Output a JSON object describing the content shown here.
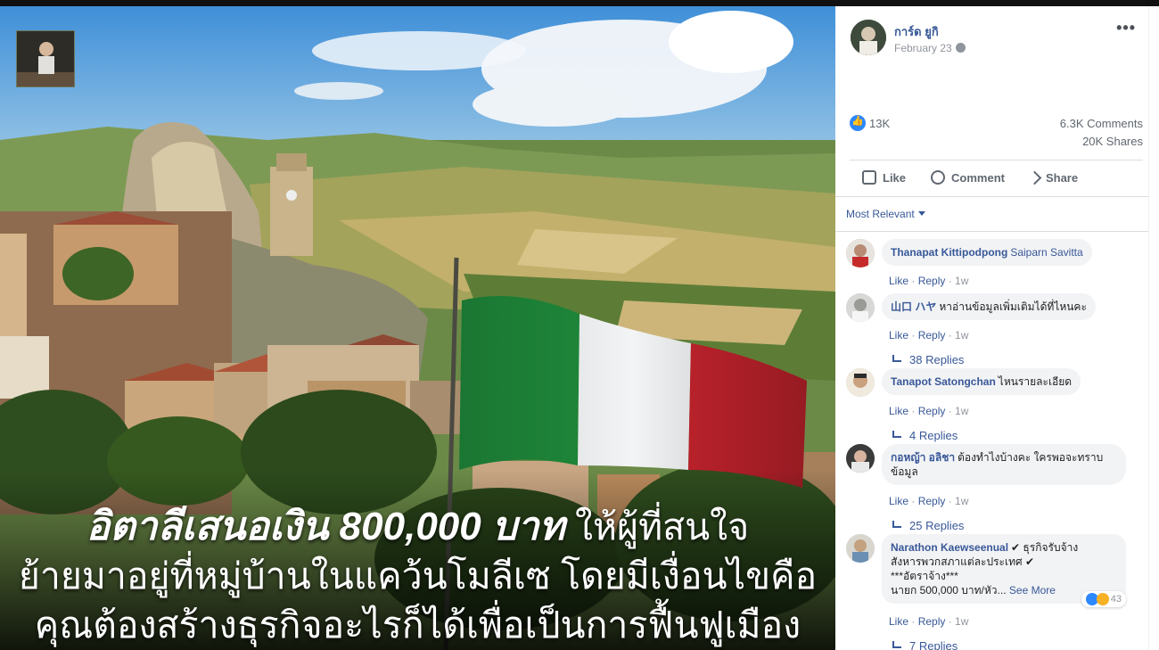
{
  "post": {
    "headline_bold": "อิตาลีเสนอเงิน 800,000 บาท",
    "headline_rest": "ให้ผู้ที่สนใจ",
    "headline_line2": "ย้ายมาอยู่ที่หมู่บ้านในแคว้นโมลีเซ โดยมีเงื่อนไขคือ",
    "headline_line3": "คุณต้องสร้างธุรกิจอะไรก็ได้เพื่อเป็นการฟื้นฟูเมือง"
  },
  "author": {
    "name": "การ์ด ยูกิ",
    "date": "February 23",
    "more": "•••"
  },
  "stats": {
    "likes": "13K",
    "comments": "6.3K Comments",
    "shares": "20K Shares"
  },
  "actions": {
    "like": "Like",
    "comment": "Comment",
    "share": "Share"
  },
  "sort": {
    "label": "Most Relevant"
  },
  "comments": [
    {
      "name": "Thanapat Kittipodpong",
      "text": "Saiparn Savitta",
      "like": "Like",
      "reply": "Reply",
      "time": "1w"
    },
    {
      "name": "山口 ハヤ",
      "text": "หาอ่านข้อมูลเพิ่มเติมได้ที่ไหนคะ",
      "like": "Like",
      "reply": "Reply",
      "time": "1w",
      "replies": "38 Replies"
    },
    {
      "name": "Tanapot Satongchan",
      "text": "ไหนรายละเอียด",
      "like": "Like",
      "reply": "Reply",
      "time": "1w",
      "replies": "4 Replies"
    },
    {
      "name": "กอหญ้า อลิชา",
      "text": "ต้องทำไงบ้างคะ ใครพอจะทราบ",
      "text2": "ข้อมูล",
      "like": "Like",
      "reply": "Reply",
      "time": "1w",
      "replies": "25 Replies"
    },
    {
      "name": "Narathon Kaewseenual",
      "text": "✔ ธุรกิจรับจ้าง",
      "text2": "สังหารพวกสภาแต่ละประเทศ ✔",
      "text3": "***อัตราจ้าง***",
      "text4": "นายก 500,000 บาท/หัว...",
      "see_more": "See More",
      "reactions": "43",
      "like": "Like",
      "reply": "Reply",
      "time": "1w",
      "replies": "7 Replies"
    }
  ]
}
